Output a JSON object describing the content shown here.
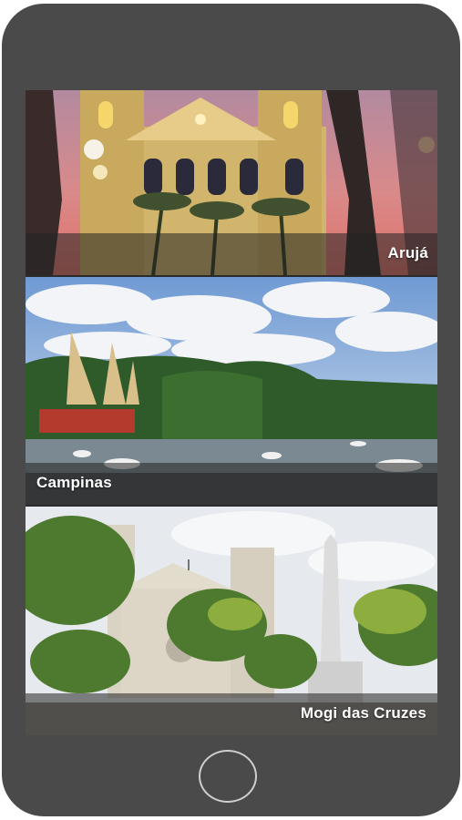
{
  "cities": [
    {
      "name": "Arujá"
    },
    {
      "name": "Campinas"
    },
    {
      "name": "Mogi das Cruzes"
    }
  ]
}
